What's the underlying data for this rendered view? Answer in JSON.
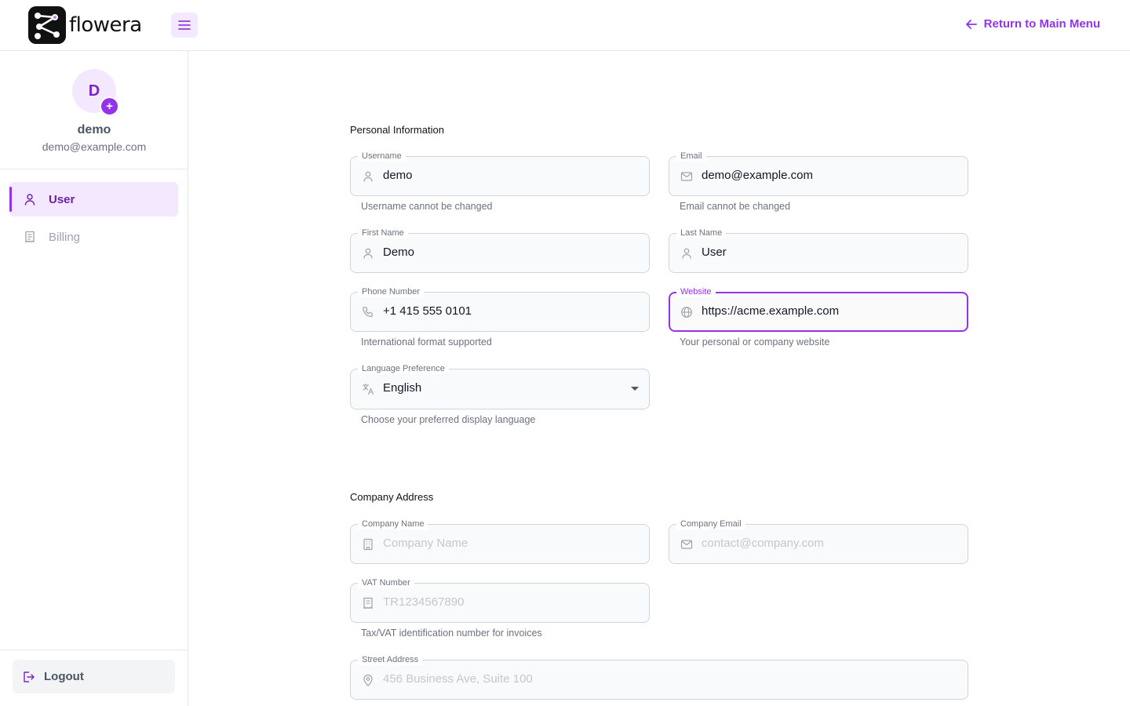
{
  "app": {
    "name": "flowera"
  },
  "header": {
    "return_label": "Return to Main Menu"
  },
  "user": {
    "initial": "D",
    "name": "demo",
    "email": "demo@example.com"
  },
  "sidebar": {
    "items": [
      {
        "label": "User",
        "icon": "user-icon",
        "active": true
      },
      {
        "label": "Billing",
        "icon": "receipt-icon",
        "active": false
      }
    ],
    "logout_label": "Logout"
  },
  "personal": {
    "title": "Personal Information",
    "username": {
      "label": "Username",
      "value": "demo",
      "helper": "Username cannot be changed"
    },
    "email": {
      "label": "Email",
      "value": "demo@example.com",
      "helper": "Email cannot be changed"
    },
    "first_name": {
      "label": "First Name",
      "value": "Demo"
    },
    "last_name": {
      "label": "Last Name",
      "value": "User"
    },
    "phone": {
      "label": "Phone Number",
      "value": "+1 415 555 0101",
      "helper": "International format supported"
    },
    "website": {
      "label": "Website",
      "value": "https://acme.example.com",
      "helper": "Your personal or company website"
    },
    "language": {
      "label": "Language Preference",
      "value": "English",
      "helper": "Choose your preferred display language"
    }
  },
  "company": {
    "title": "Company Address",
    "name": {
      "label": "Company Name",
      "placeholder": "Company Name"
    },
    "email": {
      "label": "Company Email",
      "placeholder": "contact@company.com"
    },
    "vat": {
      "label": "VAT Number",
      "placeholder": "TR1234567890",
      "helper": "Tax/VAT identification number for invoices"
    },
    "street": {
      "label": "Street Address",
      "placeholder": "456 Business Ave, Suite 100"
    }
  },
  "colors": {
    "accent": "#9333ea",
    "accent_light": "#f3e8ff"
  }
}
